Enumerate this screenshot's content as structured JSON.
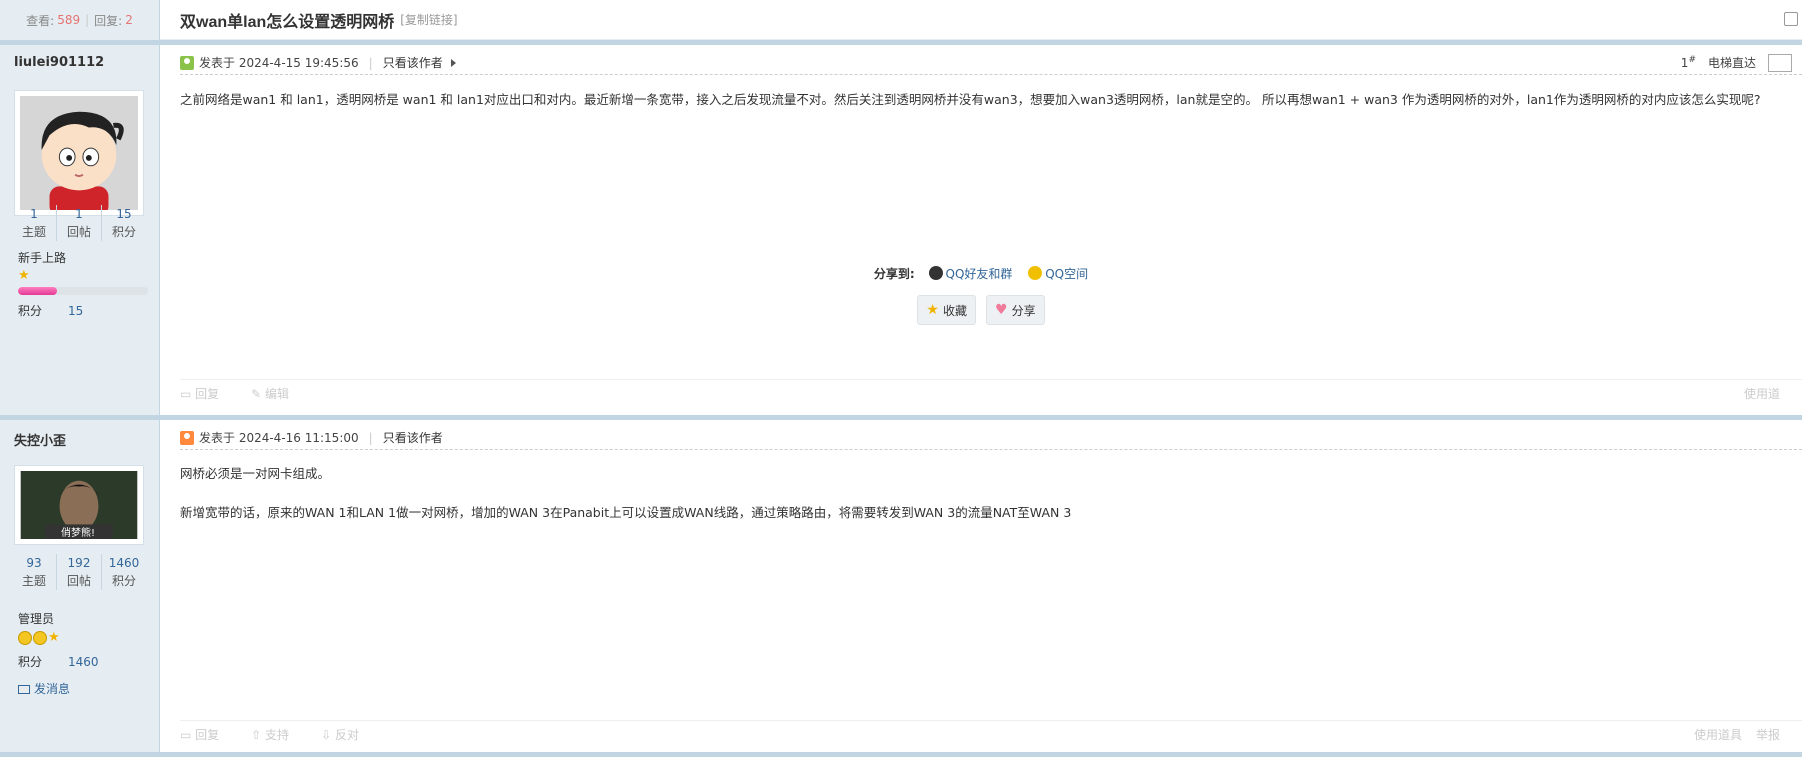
{
  "thread": {
    "views_label": "查看:",
    "views": "589",
    "replies_label": "回复:",
    "replies": "2",
    "title": "双wan单lan怎么设置透明网桥",
    "copy_link": "[复制链接]"
  },
  "posts": [
    {
      "author": "liulei901112",
      "stats": [
        {
          "value": "1",
          "label": "主题"
        },
        {
          "value": "1",
          "label": "回帖"
        },
        {
          "value": "15",
          "label": "积分"
        }
      ],
      "rank": "新手上路",
      "rank_progress": 0.3,
      "points_label": "积分",
      "points": "15",
      "posted": "发表于 2024-4-15 19:45:56",
      "only_author": "只看该作者",
      "floor": "1",
      "floor_sup": "#",
      "jump_label": "电梯直达",
      "content": "之前网络是wan1 和 lan1，透明网桥是 wan1 和 lan1对应出口和对内。最近新增一条宽带，接入之后发现流量不对。然后关注到透明网桥并没有wan3，想要加入wan3透明网桥，lan就是空的。 所以再想wan1 + wan3 作为透明网桥的对外，lan1作为透明网桥的对内应该怎么实现呢?",
      "share_label": "分享到:",
      "share_qq": "QQ好友和群",
      "share_qzone": "QQ空间",
      "fav_label": "收藏",
      "share_btn": "分享",
      "reply": "回复",
      "edit": "编辑",
      "tools": "使用道"
    },
    {
      "author": "失控小歪",
      "stats": [
        {
          "value": "93",
          "label": "主题"
        },
        {
          "value": "192",
          "label": "回帖"
        },
        {
          "value": "1460",
          "label": "积分"
        }
      ],
      "rank": "管理员",
      "points_label": "积分",
      "points": "1460",
      "send_msg": "发消息",
      "avatar_caption": "俏梦熊!",
      "posted": "发表于 2024-4-16 11:15:00",
      "only_author": "只看该作者",
      "content_1": "网桥必须是一对网卡组成。",
      "content_2": "新增宽带的话，原来的WAN 1和LAN 1做一对网桥，增加的WAN 3在Panabit上可以设置成WAN线路，通过策略路由，将需要转发到WAN 3的流量NAT至WAN 3",
      "reply": "回复",
      "support": "支持",
      "oppose": "反对",
      "tools": "使用道具",
      "report": "举报"
    }
  ],
  "colors": {
    "side_bg": "#e5edf2",
    "border": "#c2d5e3",
    "link": "#336699",
    "post1_icon": "#8bc34a",
    "post2_icon": "#ff8a3d"
  }
}
